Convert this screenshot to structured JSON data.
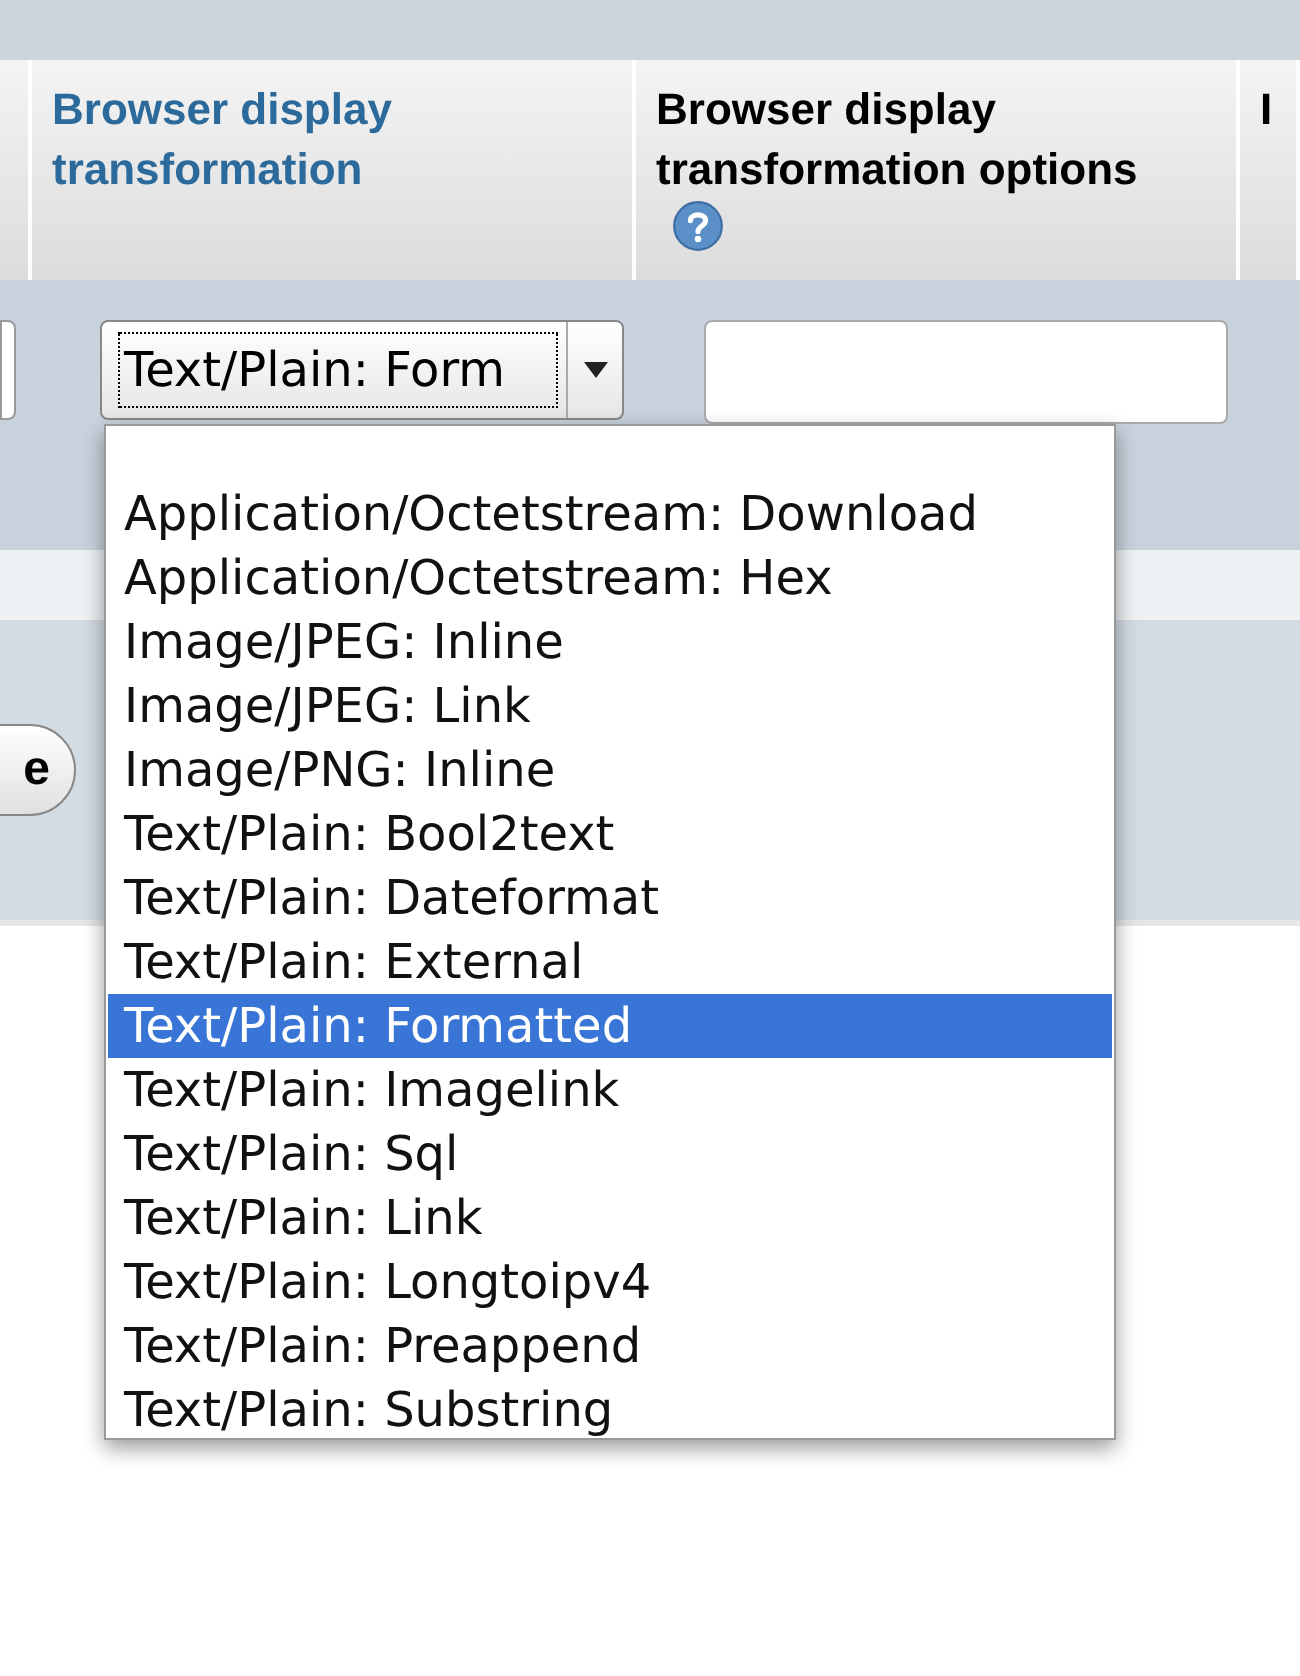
{
  "table": {
    "columns": [
      {
        "label": "Browser display transformation",
        "link": true,
        "help": false
      },
      {
        "label": "Browser display transformation options",
        "link": false,
        "help": true
      },
      {
        "label": "I",
        "link": false,
        "help": false
      }
    ],
    "row": {
      "transformation_select": {
        "value": "Text/Plain: Form",
        "expanded": true
      }
    }
  },
  "partial_button": {
    "label": "e"
  },
  "dropdown": {
    "options": [
      {
        "label": "Application/Octetstream: Download",
        "selected": false
      },
      {
        "label": "Application/Octetstream: Hex",
        "selected": false
      },
      {
        "label": "Image/JPEG: Inline",
        "selected": false
      },
      {
        "label": "Image/JPEG: Link",
        "selected": false
      },
      {
        "label": "Image/PNG: Inline",
        "selected": false
      },
      {
        "label": "Text/Plain: Bool2text",
        "selected": false
      },
      {
        "label": "Text/Plain: Dateformat",
        "selected": false
      },
      {
        "label": "Text/Plain: External",
        "selected": false
      },
      {
        "label": "Text/Plain: Formatted",
        "selected": true
      },
      {
        "label": "Text/Plain: Imagelink",
        "selected": false
      },
      {
        "label": "Text/Plain: Sql",
        "selected": false
      },
      {
        "label": "Text/Plain: Link",
        "selected": false
      },
      {
        "label": "Text/Plain: Longtoipv4",
        "selected": false
      },
      {
        "label": "Text/Plain: Preappend",
        "selected": false
      },
      {
        "label": "Text/Plain: Substring",
        "selected": false
      }
    ]
  }
}
